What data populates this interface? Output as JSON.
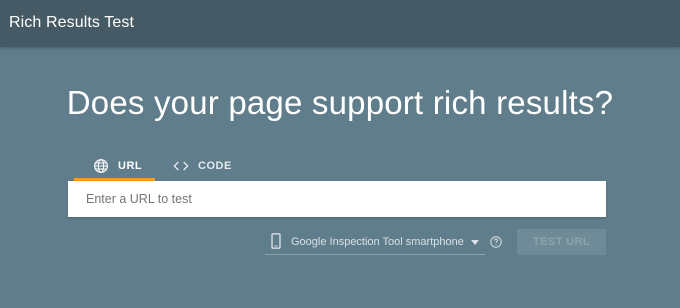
{
  "header": {
    "title": "Rich Results Test"
  },
  "main": {
    "headline": "Does your page support rich results?",
    "tabs": [
      {
        "label": "URL",
        "icon": "globe-icon",
        "selected": true
      },
      {
        "label": "CODE",
        "icon": "code-icon",
        "selected": false
      }
    ],
    "url_input": {
      "placeholder": "Enter a URL to test",
      "value": ""
    },
    "device_select": {
      "icon": "smartphone-icon",
      "selected": "Google Inspection Tool smartphone"
    },
    "help_icon": "help-icon",
    "test_button_label": "TEST URL"
  },
  "colors": {
    "header_bg": "#455a64",
    "page_bg": "#607d8b",
    "tab_underline": "#f29e1f",
    "button_disabled_bg": "#6f8b98"
  }
}
